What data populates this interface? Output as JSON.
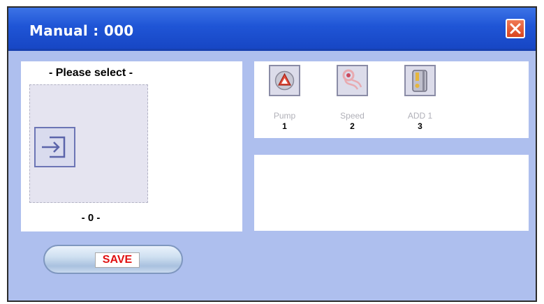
{
  "window": {
    "title": "Manual : 000"
  },
  "left_panel": {
    "heading": "- Please select -",
    "count_label": "- 0 -"
  },
  "tools": [
    {
      "label": "Pump",
      "number": "1",
      "icon": "pump-icon"
    },
    {
      "label": "Speed",
      "number": "2",
      "icon": "speed-icon"
    },
    {
      "label": "ADD 1",
      "number": "3",
      "icon": "add-valve-icon"
    }
  ],
  "save": {
    "label": "SAVE"
  },
  "colors": {
    "titlebar": "#1f55d6",
    "background": "#aebfee",
    "close": "#d9441f",
    "save_text": "#e01010"
  }
}
